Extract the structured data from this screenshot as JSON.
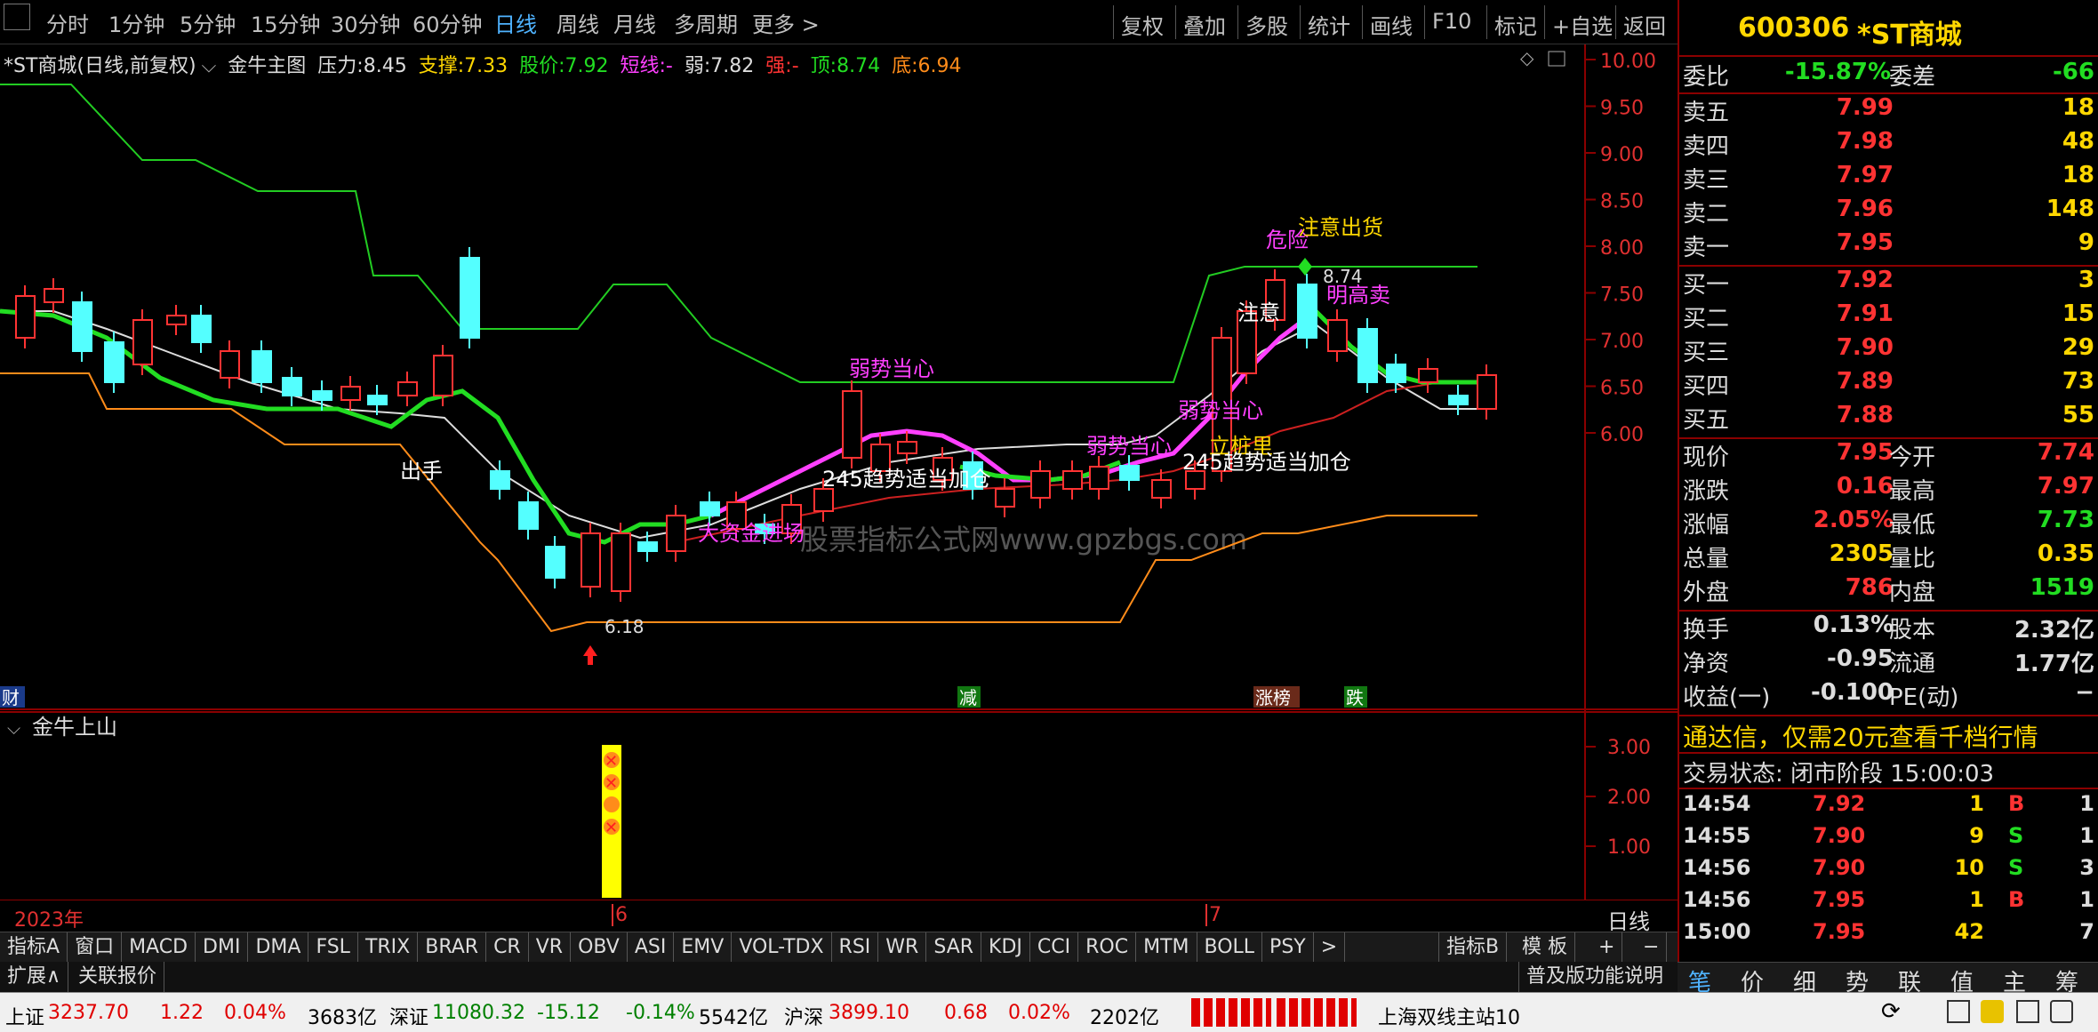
{
  "toolbar": {
    "periods": [
      "分时",
      "1分钟",
      "5分钟",
      "15分钟",
      "30分钟",
      "60分钟",
      "日线",
      "周线",
      "月线",
      "多周期",
      "更多 >"
    ],
    "active": "日线",
    "right": [
      "复权",
      "叠加",
      "多股",
      "统计",
      "画线",
      "F10",
      "标记",
      "+自选",
      "返回"
    ]
  },
  "info": {
    "title": "*ST商城(日线,前复权)",
    "indicator": "金牛主图",
    "pressure_label": "压力:",
    "pressure": "8.45",
    "support_label": "支撑:",
    "support": "7.33",
    "price_label": "股价:",
    "price": "7.92",
    "short_label": "短线:",
    "short": "-",
    "weak_label": "弱:",
    "weak": "7.82",
    "strong_label": "强:",
    "strong": "-",
    "top_label": "顶:",
    "top": "8.74",
    "bottom_label": "底:",
    "bottom": "6.94"
  },
  "main_axis": [
    "10.00",
    "9.50",
    "9.00",
    "8.50",
    "8.00",
    "7.50",
    "7.00",
    "6.50",
    "6.00"
  ],
  "sub_axis": [
    "3.00",
    "2.00",
    "1.00"
  ],
  "sub_title": "金牛上山",
  "annotations": {
    "chushou": "出手",
    "dazijin": "大资金进场",
    "ruoshi1": "弱势当心",
    "qushi1": "245趋势适当加仓",
    "ruoshi2": "弱势当心",
    "ruoshi3": "弱势当心",
    "lizhuang": "立桩里",
    "qushi2": "245趋势适当加仓",
    "zhuyi": "注意",
    "weixian": "危险",
    "zhuyichuhuo": "注意出货",
    "minggaomai": "明高卖",
    "high_mark": "8.74",
    "low_mark": "6.18",
    "watermark": "股票指标公式网www.gpzbgs.com",
    "badge_jian": "减",
    "badge_zhangbang": "涨榜",
    "badge_die": "跌",
    "badge_cai": "财"
  },
  "dates": {
    "year": "2023年",
    "m6": "6",
    "m7": "7",
    "period": "日线"
  },
  "indicator_tabs": [
    "指标A",
    "窗口",
    "MACD",
    "DMI",
    "DMA",
    "FSL",
    "TRIX",
    "BRAR",
    "CR",
    "VR",
    "OBV",
    "ASI",
    "EMV",
    "VOL-TDX",
    "RSI",
    "WR",
    "SAR",
    "KDJ",
    "CCI",
    "ROC",
    "MTM",
    "BOLL",
    "PSY",
    ">"
  ],
  "indicator_b": "指标B",
  "template": "模 板",
  "plus": "+",
  "minus": "−",
  "row2": {
    "expand": "扩展∧",
    "related": "关联报价",
    "notice": "普及版功能说明"
  },
  "status": {
    "sh_label": "上证",
    "sh": "3237.70",
    "sh_chg": "1.22",
    "sh_pct": "0.04%",
    "sh_amt": "3683亿",
    "sz_label": "深证",
    "sz": "11080.32",
    "sz_chg": "-15.12",
    "sz_pct": "-0.14%",
    "sz_amt": "5542亿",
    "hs_label": "沪深",
    "hs": "3899.10",
    "hs_chg": "0.68",
    "hs_pct": "0.02%",
    "hs_amt": "2202亿",
    "server": "上海双线主站10"
  },
  "panel": {
    "code": "600306",
    "name": "*ST商城",
    "wb_label": "委比",
    "wb": "-15.87%",
    "wc_label": "委差",
    "wc": "-66",
    "asks": [
      {
        "l": "卖五",
        "p": "7.99",
        "v": "18"
      },
      {
        "l": "卖四",
        "p": "7.98",
        "v": "48"
      },
      {
        "l": "卖三",
        "p": "7.97",
        "v": "18"
      },
      {
        "l": "卖二",
        "p": "7.96",
        "v": "148"
      },
      {
        "l": "卖一",
        "p": "7.95",
        "v": "9"
      }
    ],
    "bids": [
      {
        "l": "买一",
        "p": "7.92",
        "v": "3"
      },
      {
        "l": "买二",
        "p": "7.91",
        "v": "15"
      },
      {
        "l": "买三",
        "p": "7.90",
        "v": "29"
      },
      {
        "l": "买四",
        "p": "7.89",
        "v": "73"
      },
      {
        "l": "买五",
        "p": "7.88",
        "v": "55"
      }
    ],
    "quote": [
      {
        "l1": "现价",
        "v1": "7.95",
        "l2": "今开",
        "v2": "7.74"
      },
      {
        "l1": "涨跌",
        "v1": "0.16",
        "l2": "最高",
        "v2": "7.97"
      },
      {
        "l1": "涨幅",
        "v1": "2.05%",
        "l2": "最低",
        "v2": "7.73"
      },
      {
        "l1": "总量",
        "v1": "2305",
        "l2": "量比",
        "v2": "0.35"
      },
      {
        "l1": "外盘",
        "v1": "786",
        "l2": "内盘",
        "v2": "1519"
      }
    ],
    "fund": [
      {
        "l1": "换手",
        "v1": "0.13%",
        "l2": "股本",
        "v2": "2.32亿"
      },
      {
        "l1": "净资",
        "v1": "-0.95",
        "l2": "流通",
        "v2": "1.77亿"
      },
      {
        "l1": "收益(一)",
        "v1": "-0.100",
        "l2": "PE(动)",
        "v2": "−"
      }
    ],
    "ad": "通达信，仅需20元查看千档行情",
    "state": "交易状态: 闭市阶段 15:00:03",
    "trades": [
      {
        "t": "14:54",
        "p": "7.92",
        "v": "1",
        "bs": "B",
        "n": "1"
      },
      {
        "t": "14:55",
        "p": "7.90",
        "v": "9",
        "bs": "S",
        "n": "1"
      },
      {
        "t": "14:56",
        "p": "7.90",
        "v": "10",
        "bs": "S",
        "n": "3"
      },
      {
        "t": "14:56",
        "p": "7.95",
        "v": "1",
        "bs": "B",
        "n": "1"
      },
      {
        "t": "15:00",
        "p": "7.95",
        "v": "42",
        "bs": "",
        "n": "7"
      }
    ],
    "btabs": [
      "笔",
      "价",
      "细",
      "势",
      "联",
      "值",
      "主",
      "筹"
    ]
  },
  "colors": {
    "up": "#ff3333",
    "down": "#54ffff",
    "axis": "#8b0000",
    "pink": "#ff40ff",
    "green": "#22dd22"
  }
}
